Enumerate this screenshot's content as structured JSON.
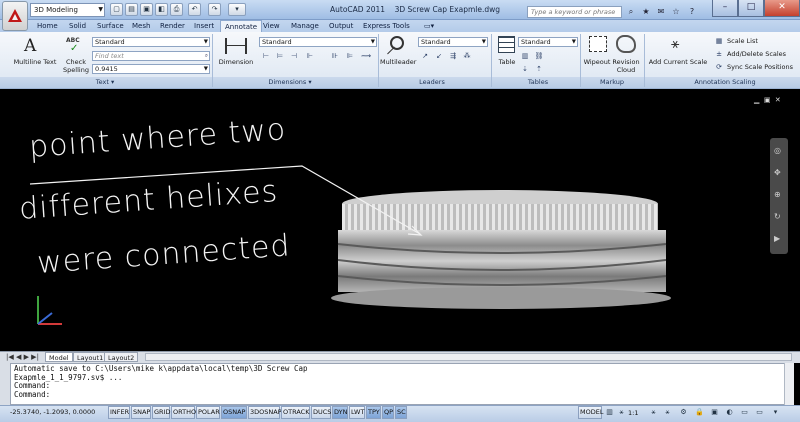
{
  "window": {
    "app_title": "AutoCAD 2011",
    "doc_title": "3D Screw Cap Exapmle.dwg",
    "workspace": "3D Modeling",
    "search_placeholder": "Type a keyword or phrase"
  },
  "quick_access": [
    "new-icon",
    "open-icon",
    "save-icon",
    "saveas-icon",
    "print-icon",
    "undo-icon",
    "redo-icon"
  ],
  "tabs": [
    "Home",
    "Solid",
    "Surface",
    "Mesh",
    "Render",
    "Insert",
    "Annotate",
    "View",
    "Manage",
    "Output",
    "Express Tools"
  ],
  "active_tab": "Annotate",
  "ribbon": {
    "text_panel": {
      "label": "Text",
      "multiline_text": "Multiline Text",
      "check_spelling": "Check Spelling",
      "style": "Standard",
      "find_placeholder": "Find text",
      "height": "0.9415"
    },
    "dimensions_panel": {
      "label": "Dimensions",
      "dimension": "Dimension",
      "style": "Standard"
    },
    "leaders_panel": {
      "label": "Leaders",
      "multileader": "Multileader",
      "style": "Standard"
    },
    "tables_panel": {
      "label": "Tables",
      "table": "Table",
      "style": "Standard"
    },
    "markup_panel": {
      "label": "Markup",
      "wipeout": "Wipeout",
      "revision_cloud": "Revision Cloud"
    },
    "annotation_scaling_panel": {
      "label": "Annotation Scaling",
      "add_current_scale": "Add Current Scale",
      "scale_list": "Scale List",
      "add_delete_scales": "Add/Delete Scales",
      "sync_scale_positions": "Sync Scale Positions"
    }
  },
  "drawing": {
    "annotation_lines": [
      "point where two",
      "different helixes",
      "were connected"
    ]
  },
  "layout_tabs": [
    "Model",
    "Layout1",
    "Layout2"
  ],
  "active_layout": "Model",
  "command_lines": [
    "Automatic save to C:\\Users\\mike k\\appdata\\local\\temp\\3D Screw Cap",
    "Exapmle_1_1_9797.sv$ ...",
    "Command:",
    "Command:"
  ],
  "status": {
    "coords": "-25.3740, -1.2093, 0.0000",
    "toggles": [
      {
        "label": "INFER",
        "on": false
      },
      {
        "label": "SNAP",
        "on": false
      },
      {
        "label": "GRID",
        "on": false
      },
      {
        "label": "ORTHO",
        "on": false
      },
      {
        "label": "POLAR",
        "on": false
      },
      {
        "label": "OSNAP",
        "on": true
      },
      {
        "label": "3DOSNAP",
        "on": false
      },
      {
        "label": "OTRACK",
        "on": false
      },
      {
        "label": "DUCS",
        "on": false
      },
      {
        "label": "DYN",
        "on": true
      },
      {
        "label": "LWT",
        "on": false
      },
      {
        "label": "TPY",
        "on": true
      },
      {
        "label": "QP",
        "on": true
      },
      {
        "label": "SC",
        "on": true
      }
    ],
    "model": "MODEL",
    "scale": "1:1"
  }
}
